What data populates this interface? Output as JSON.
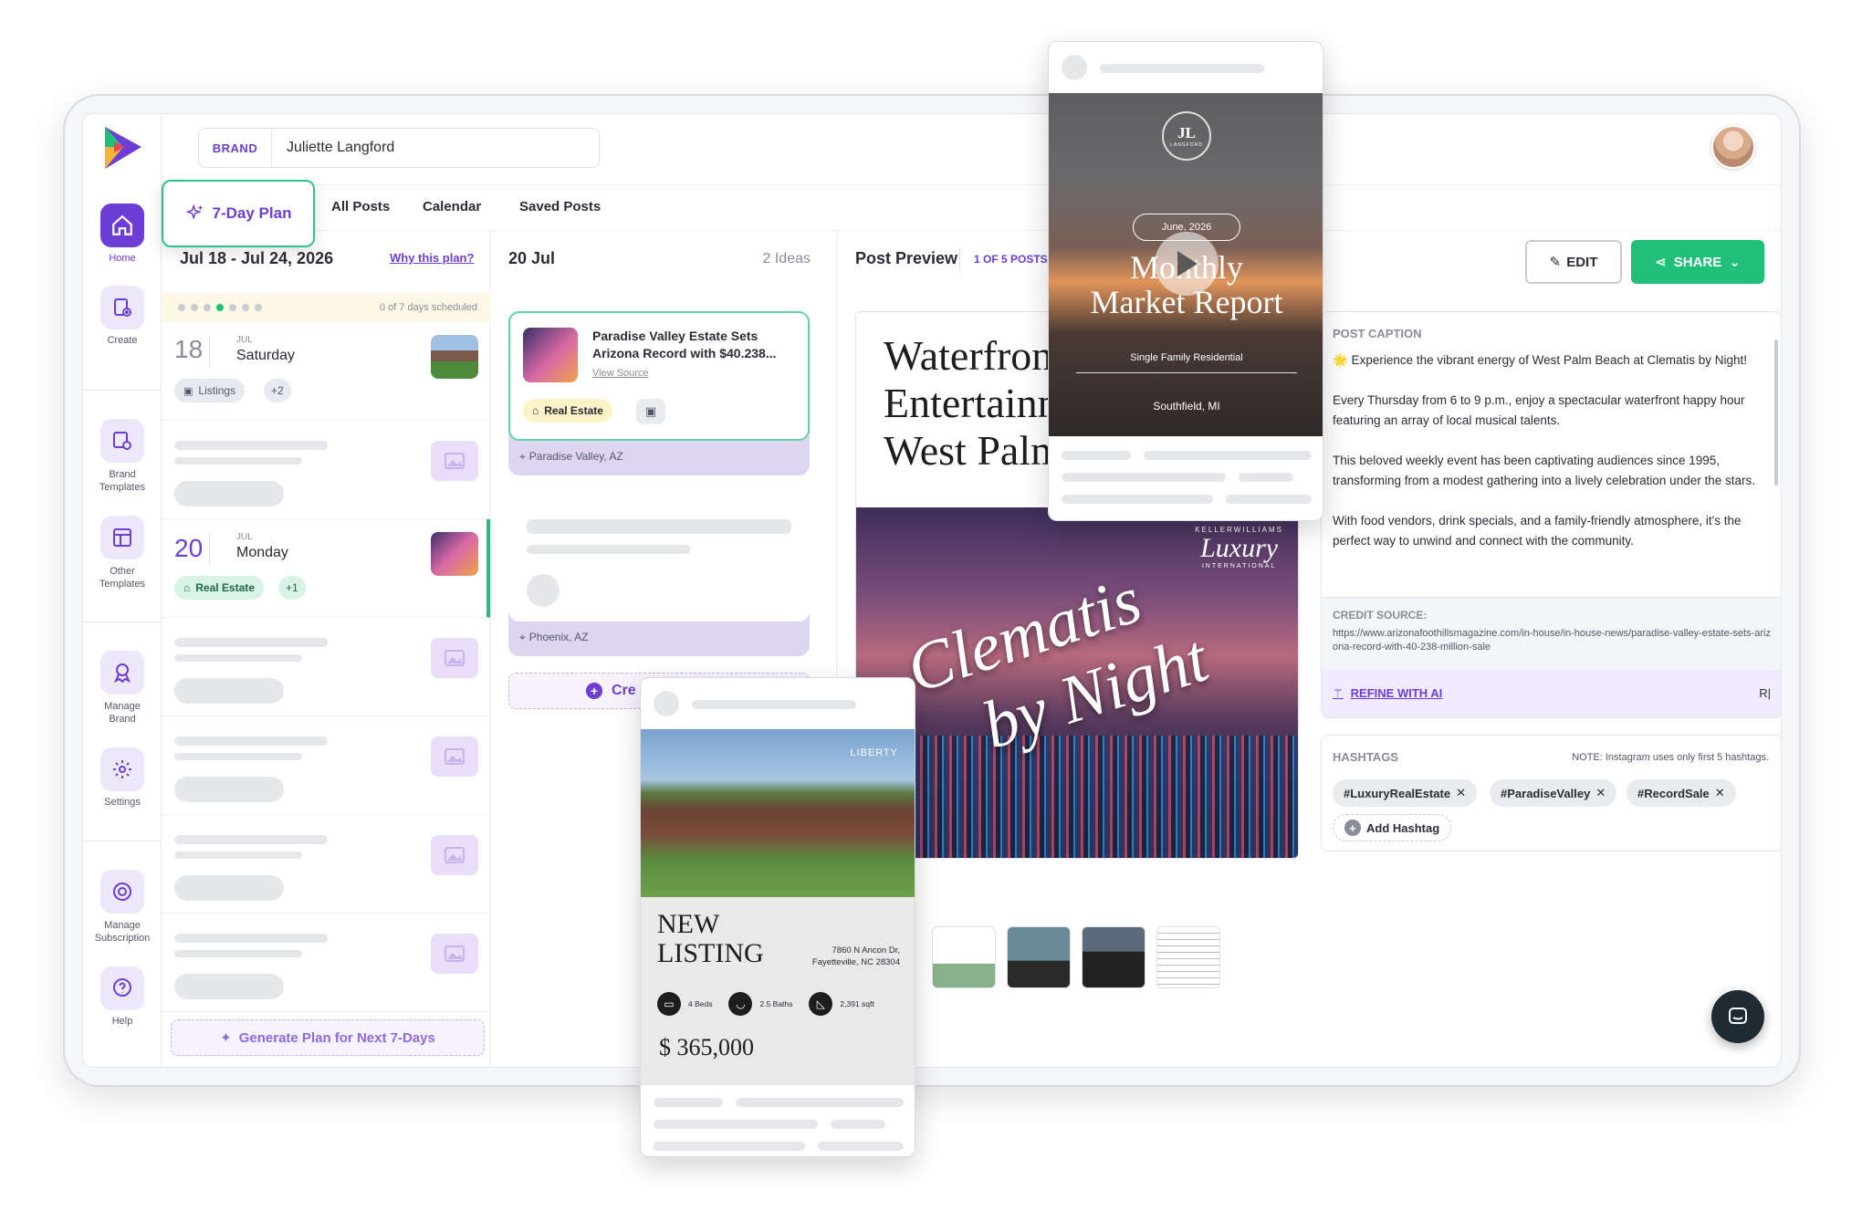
{
  "brand": {
    "label": "BRAND",
    "name": "Juliette Langford"
  },
  "sidebar": {
    "home": "Home",
    "create": "Create",
    "brand_templates": "Brand Templates",
    "other_templates": "Other Templates",
    "manage_brand": "Manage Brand",
    "settings": "Settings",
    "manage_subscription": "Manage Subscription",
    "help": "Help"
  },
  "tabs": {
    "seven_day": "7-Day Plan",
    "all_posts": "All Posts",
    "calendar": "Calendar",
    "saved_posts": "Saved Posts"
  },
  "plan": {
    "range": "Jul 18 - Jul 24, 2026",
    "why_link": "Why this plan?",
    "scheduled": "0 of 7 days scheduled",
    "day1": {
      "num": "18",
      "month": "JUL",
      "weekday": "Saturday",
      "category": "Listings",
      "extra": "+2"
    },
    "day2": {
      "num": "20",
      "month": "JUL",
      "weekday": "Monday",
      "category": "Real Estate",
      "extra": "+1"
    },
    "generate": "Generate Plan for Next 7-Days"
  },
  "ideas": {
    "date": "20 Jul",
    "count": "2 Ideas",
    "card1": {
      "title": "Paradise Valley Estate Sets Arizona Record with $40.238...",
      "source": "View Source",
      "category": "Real Estate",
      "location": "Paradise Valley, AZ"
    },
    "card2": {
      "location": "Phoenix, AZ"
    },
    "create": "Cre"
  },
  "preview": {
    "title": "Post Preview",
    "counter": "1 OF 5 POSTS",
    "edit": "EDIT",
    "share": "SHARE",
    "headline": [
      "Waterfront",
      "Entertainment",
      "West Palm"
    ],
    "brand_small": "KELLERWILLIAMS",
    "brand_big": "Luxury",
    "brand_sub": "INTERNATIONAL",
    "script": [
      "Clematis",
      "by Night"
    ],
    "caption_label": "POST CAPTION",
    "caption": [
      "🌟 Experience the vibrant energy of West Palm Beach at Clematis by Night!",
      "Every Thursday from 6 to 9 p.m., enjoy a spectacular waterfront happy hour featuring an array of local musical talents.",
      "This beloved weekly event has been captivating audiences since 1995, transforming from a modest gathering into a lively celebration under the stars.",
      "With food vendors, drink specials, and a family-friendly atmosphere, it's the perfect way to unwind and connect with the community."
    ],
    "credit_label": "CREDIT SOURCE:",
    "credit_url": "https://www.arizonafoothillsmagazine.com/in-house/in-house-news/paradise-valley-estate-sets-arizona-record-with-40-238-million-sale",
    "refine": "REFINE WITH AI",
    "refine_right": "R|",
    "hashtags_label": "HASHTAGS",
    "hashtags_note": "NOTE: Instagram uses only first 5 hashtags.",
    "hashtags": [
      "#LuxuryRealEstate",
      "#ParadiseValley",
      "#RecordSale"
    ],
    "add_hashtag": "Add Hashtag"
  },
  "market_card": {
    "logo": "JL",
    "logo_sub": "LANGFORD",
    "date": "June, 2026",
    "title": [
      "Monthly",
      "Market Report"
    ],
    "subtitle": "Single Family Residential",
    "location": "Southfield, MI"
  },
  "listing_card": {
    "watermark": "LIBERTY",
    "title": [
      "NEW",
      "LISTING"
    ],
    "address": [
      "7860 N Ancon Dr,",
      "Fayetteville, NC 28304"
    ],
    "beds": "4 Beds",
    "baths": "2.5 Baths",
    "sqft": "2,391 sqft",
    "price": "$ 365,000"
  },
  "colors": {
    "accent": "#6c3ed6",
    "green": "#21c07a",
    "lavender": "#ece7f9"
  }
}
